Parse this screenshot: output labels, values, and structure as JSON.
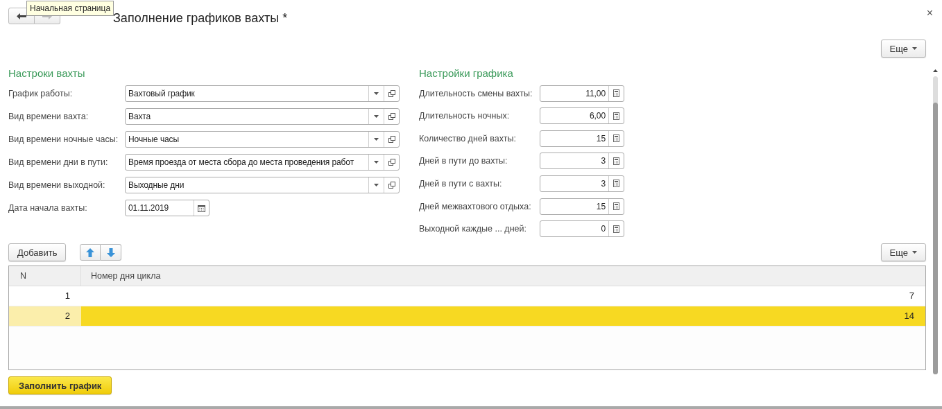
{
  "window": {
    "title": "Заполнение графиков вахты *",
    "close": "×"
  },
  "tooltip": "Начальная страница",
  "top_more": "Еще",
  "watch_settings": {
    "title": "Настроки вахты",
    "fields": [
      {
        "kind": "select",
        "label": "График работы:",
        "value": "Вахтовый график"
      },
      {
        "kind": "select",
        "label": "Вид времени вахта:",
        "value": "Вахта"
      },
      {
        "kind": "select",
        "label": "Вид времени ночные часы:",
        "value": "Ночные часы"
      },
      {
        "kind": "select",
        "label": "Вид времени дни в пути:",
        "value": "Время проезда от места сбора до места проведения работ"
      },
      {
        "kind": "select",
        "label": "Вид времени выходной:",
        "value": "Выходные дни"
      },
      {
        "kind": "date",
        "label": "Дата начала вахты:",
        "value": "01.11.2019"
      }
    ]
  },
  "schedule_settings": {
    "title": "Настройки графика",
    "fields": [
      {
        "label": "Длительность смены вахты:",
        "value": "11,00"
      },
      {
        "label": "Длительность ночных:",
        "value": "6,00"
      },
      {
        "label": "Количество дней вахты:",
        "value": "15"
      },
      {
        "label": "Дней в пути до вахты:",
        "value": "3"
      },
      {
        "label": "Дней в пути с вахты:",
        "value": "3"
      },
      {
        "label": "Дней межвахтового отдыха:",
        "value": "15"
      },
      {
        "label": "Выходной каждые ... дней:",
        "value": "0"
      }
    ]
  },
  "table_toolbar": {
    "add": "Добавить",
    "more": "Еще"
  },
  "table": {
    "columns": [
      "N",
      "Номер дня цикла"
    ],
    "rows": [
      {
        "n": "1",
        "day": "7",
        "selected": false
      },
      {
        "n": "2",
        "day": "14",
        "selected": true
      }
    ]
  },
  "fill_button": "Заполнить график"
}
